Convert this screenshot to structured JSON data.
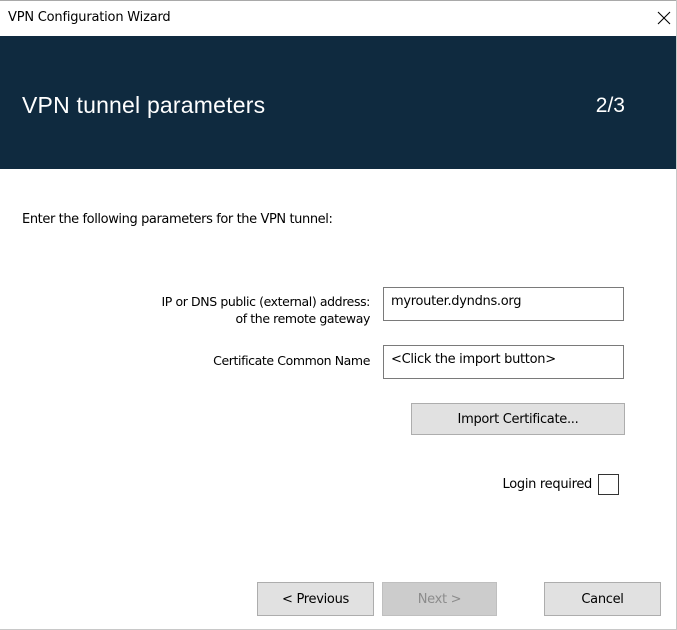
{
  "window": {
    "title": "VPN Configuration Wizard",
    "close_symbol": "✕"
  },
  "header": {
    "title": "VPN tunnel parameters",
    "step": "2/3",
    "background_color": "#0f2a3f"
  },
  "intro": "Enter the following parameters for the VPN tunnel:",
  "form": {
    "ip_label_line1": "IP or DNS public (external) address:",
    "ip_label_line2": "of the remote gateway",
    "ip_value": "myrouter.dyndns.org",
    "cert_label": "Certificate Common Name",
    "cert_value": "<Click the import button>",
    "import_button": "Import Certificate...",
    "login_label": "Login required",
    "login_checked": false
  },
  "footer": {
    "previous_label": "< Previous",
    "next_label": "Next >",
    "next_enabled": false,
    "cancel_label": "Cancel"
  }
}
